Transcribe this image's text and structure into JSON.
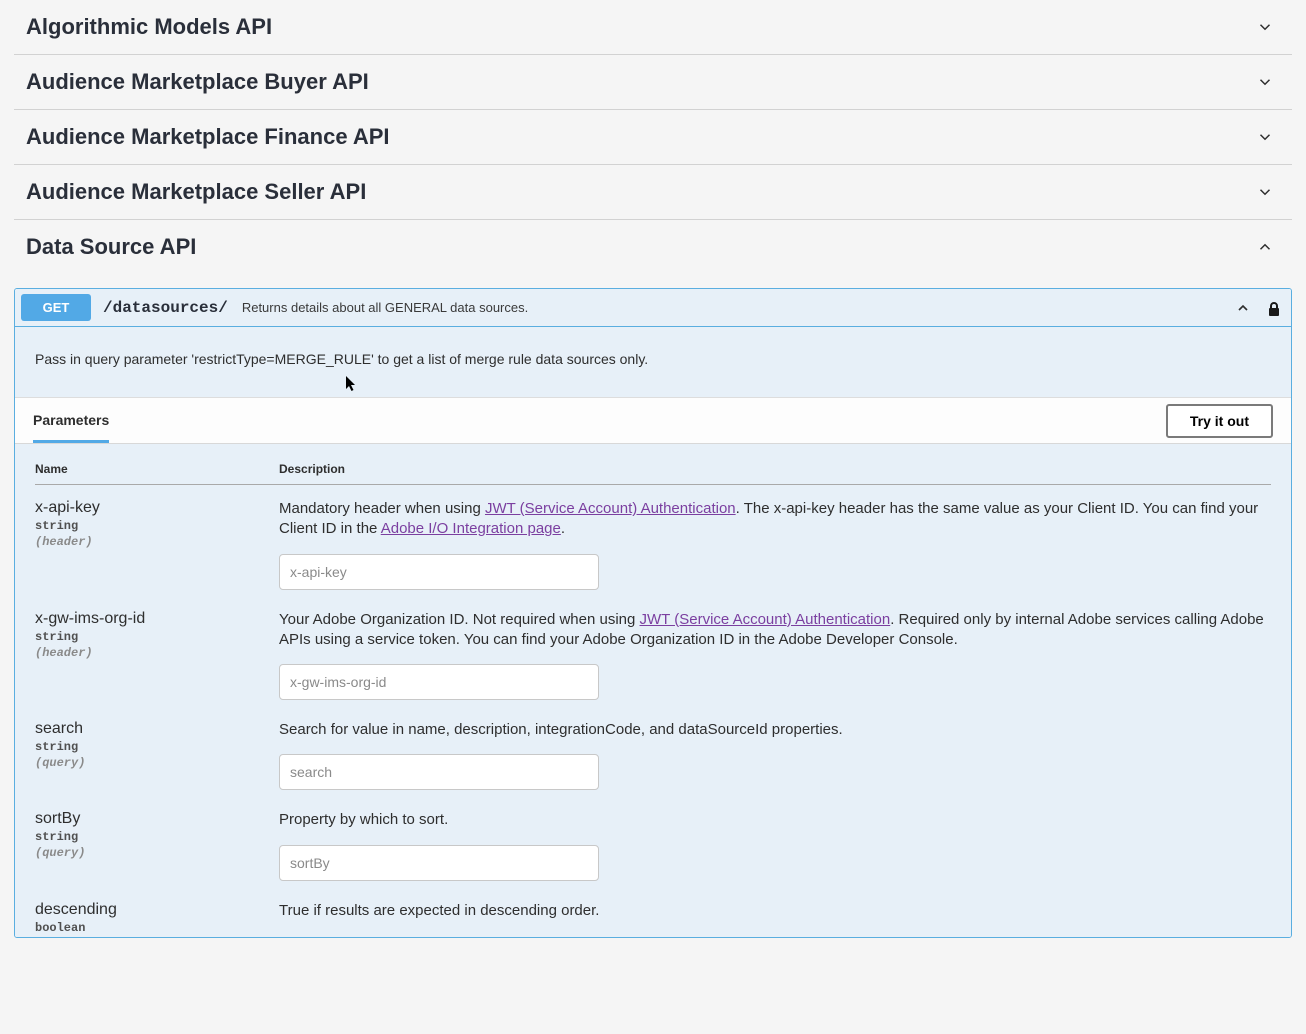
{
  "sections": [
    {
      "title": "Algorithmic Models API",
      "expanded": false
    },
    {
      "title": "Audience Marketplace Buyer API",
      "expanded": false
    },
    {
      "title": "Audience Marketplace Finance API",
      "expanded": false
    },
    {
      "title": "Audience Marketplace Seller API",
      "expanded": false
    },
    {
      "title": "Data Source API",
      "expanded": true
    }
  ],
  "endpoint": {
    "method": "GET",
    "path": "/datasources/",
    "summary": "Returns details about all GENERAL data sources.",
    "description": "Pass in query parameter 'restrictType=MERGE_RULE' to get a list of merge rule data sources only."
  },
  "paramsBar": {
    "tabLabel": "Parameters",
    "tryLabel": "Try it out"
  },
  "paramsHead": {
    "name": "Name",
    "desc": "Description"
  },
  "params": [
    {
      "name": "x-api-key",
      "type": "string",
      "in": "(header)",
      "desc_pre": "Mandatory header when using ",
      "link1_text": "JWT (Service Account) Authentication",
      "desc_mid": ". The x-api-key header has the same value as your Client ID. You can find your Client ID in the ",
      "link2_text": "Adobe I/O Integration page",
      "desc_post": ".",
      "placeholder": "x-api-key"
    },
    {
      "name": "x-gw-ims-org-id",
      "type": "string",
      "in": "(header)",
      "desc_pre": "Your Adobe Organization ID. Not required when using ",
      "link1_text": "JWT (Service Account) Authentication",
      "desc_mid": ". Required only by internal Adobe services calling Adobe APIs using a service token. You can find your Adobe Organization ID in the Adobe Developer Console.",
      "link2_text": "",
      "desc_post": "",
      "placeholder": "x-gw-ims-org-id"
    },
    {
      "name": "search",
      "type": "string",
      "in": "(query)",
      "desc_pre": "Search for value in name, description, integrationCode, and dataSourceId properties.",
      "link1_text": "",
      "desc_mid": "",
      "link2_text": "",
      "desc_post": "",
      "placeholder": "search"
    },
    {
      "name": "sortBy",
      "type": "string",
      "in": "(query)",
      "desc_pre": "Property by which to sort.",
      "link1_text": "",
      "desc_mid": "",
      "link2_text": "",
      "desc_post": "",
      "placeholder": "sortBy"
    },
    {
      "name": "descending",
      "type": "boolean",
      "in": "",
      "desc_pre": "True if results are expected in descending order.",
      "link1_text": "",
      "desc_mid": "",
      "link2_text": "",
      "desc_post": "",
      "placeholder": ""
    }
  ]
}
